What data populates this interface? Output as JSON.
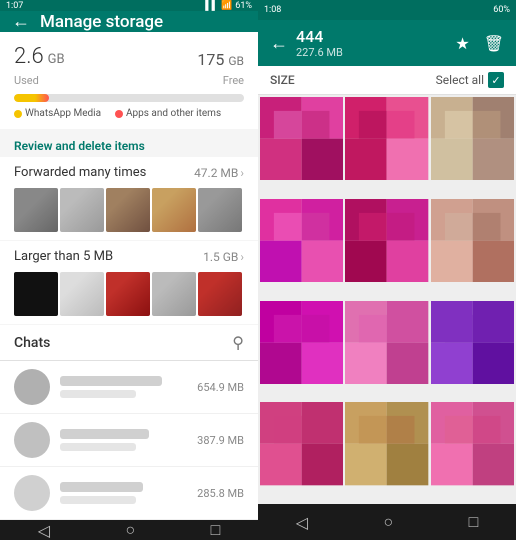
{
  "left": {
    "statusBar": {
      "time": "1:07",
      "signal": "▌▌▌",
      "wifi": "WiFi",
      "battery": "61%"
    },
    "toolbar": {
      "title": "Manage storage",
      "backIcon": "←"
    },
    "storage": {
      "used": "2.6",
      "usedUnit": "GB",
      "freeNum": "175",
      "freeUnit": "GB",
      "freeLabel": "Free",
      "usedLabel": "Used",
      "progressPercent": 15,
      "legend": [
        {
          "label": "WhatsApp Media",
          "color": "#f5c400"
        },
        {
          "label": "Apps and other items",
          "color": "#ff5252"
        }
      ]
    },
    "reviewSection": {
      "header": "Review and delete items",
      "items": [
        {
          "label": "Forwarded many times",
          "size": "47.2 MB"
        },
        {
          "label": "Larger than 5 MB",
          "size": "1.5 GB"
        }
      ]
    },
    "chats": {
      "label": "Chats",
      "rows": [
        {
          "size": "654.9 MB"
        },
        {
          "size": "387.9 MB"
        },
        {
          "size": "285.8 MB"
        }
      ]
    },
    "navBar": {
      "backIcon": "◁",
      "homeIcon": "○",
      "recentIcon": "□"
    }
  },
  "right": {
    "statusBar": {
      "time": "1:08",
      "battery": "60%"
    },
    "toolbar": {
      "backIcon": "←",
      "contactName": "444",
      "contactSize": "227.6 MB",
      "starIcon": "★",
      "deleteIcon": "🗑"
    },
    "gridControls": {
      "sizeLabel": "SIZE",
      "selectAllLabel": "Select all"
    },
    "navBar": {
      "backIcon": "◁",
      "homeIcon": "○",
      "recentIcon": "□"
    },
    "photos": [
      {
        "colors": [
          "#c8207a",
          "#e040a0",
          "#d03080",
          "#a01060",
          "#e060b0",
          "#b82070"
        ]
      },
      {
        "colors": [
          "#d0206a",
          "#e85090",
          "#c01860",
          "#f070b0",
          "#b01058",
          "#e03080"
        ]
      },
      {
        "colors": [
          "#c8b090",
          "#a08070",
          "#d0c0a0",
          "#b09080",
          "#e0d0b0",
          "#c0a080"
        ]
      },
      {
        "colors": [
          "#e030a0",
          "#d020a0",
          "#c010b0",
          "#e850b0",
          "#f060c0",
          "#d040a0"
        ]
      },
      {
        "colors": [
          "#b01060",
          "#c82090",
          "#a00850",
          "#e040a0",
          "#d02070",
          "#c01878"
        ]
      },
      {
        "colors": [
          "#d0a090",
          "#c09080",
          "#e0b0a0",
          "#b07060",
          "#d0b0a0",
          "#a07060"
        ]
      },
      {
        "colors": [
          "#c000a0",
          "#d010b0",
          "#b00890",
          "#e030c0",
          "#d020b0",
          "#c010a0"
        ]
      },
      {
        "colors": [
          "#e070b0",
          "#d050a0",
          "#f080c0",
          "#c04090",
          "#e060b0",
          "#d050a0"
        ]
      },
      {
        "colors": [
          "#8030c0",
          "#7020b0",
          "#9040d0",
          "#6010a0",
          "#8030c0",
          "#7020b0"
        ]
      },
      {
        "colors": [
          "#d04080",
          "#c03070",
          "#e05090",
          "#b02060",
          "#d04080",
          "#c03070"
        ]
      },
      {
        "colors": [
          "#c8a060",
          "#b09050",
          "#d0b070",
          "#a08040",
          "#c09050",
          "#b07040"
        ]
      },
      {
        "colors": [
          "#e060a0",
          "#d05090",
          "#f070b0",
          "#c04080",
          "#e06090",
          "#d04080"
        ]
      }
    ]
  }
}
